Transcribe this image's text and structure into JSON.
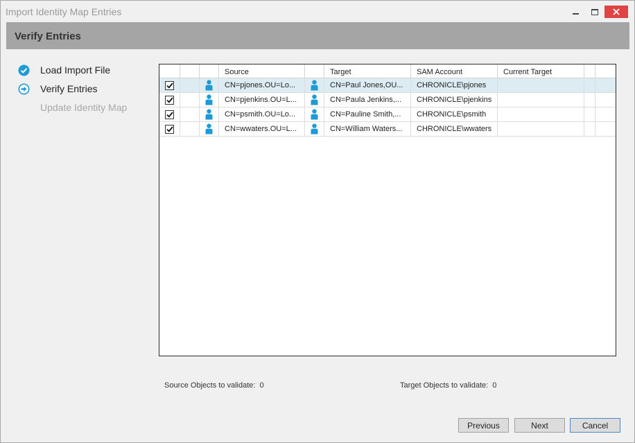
{
  "window": {
    "title": "Import Identity Map Entries"
  },
  "header": {
    "title": "Verify Entries"
  },
  "steps": [
    {
      "label": "Load Import File",
      "state": "completed",
      "icon": "check-circle-icon"
    },
    {
      "label": "Verify Entries",
      "state": "current",
      "icon": "arrow-circle-icon"
    },
    {
      "label": "Update Identity Map",
      "state": "pending",
      "icon": ""
    }
  ],
  "grid": {
    "columns": [
      "",
      "",
      "",
      "Source",
      "",
      "Target",
      "SAM Account",
      "Current Target",
      ""
    ],
    "rows": [
      {
        "checked": true,
        "source": "CN=pjones.OU=Lo...",
        "target": "CN=Paul Jones,OU...",
        "sam": "CHRONICLE\\pjones",
        "current": "",
        "selected": true
      },
      {
        "checked": true,
        "source": "CN=pjenkins.OU=L...",
        "target": "CN=Paula Jenkins,...",
        "sam": "CHRONICLE\\pjenkins",
        "current": "",
        "selected": false
      },
      {
        "checked": true,
        "source": "CN=psmith.OU=Lo...",
        "target": "CN=Pauline Smith,...",
        "sam": "CHRONICLE\\psmith",
        "current": "",
        "selected": false
      },
      {
        "checked": true,
        "source": "CN=wwaters.OU=L...",
        "target": "CN=William Waters...",
        "sam": "CHRONICLE\\wwaters",
        "current": "",
        "selected": false
      }
    ],
    "user_icon": "user-icon"
  },
  "footer": {
    "source_label": "Source Objects to validate:",
    "source_value": "0",
    "target_label": "Target Objects to validate:",
    "target_value": "0"
  },
  "buttons": {
    "previous": "Previous",
    "next": "Next",
    "cancel": "Cancel"
  },
  "colors": {
    "accent": "#1e9ad6",
    "header_bg": "#a5a5a5",
    "selected_row": "#dcecf2",
    "close_button": "#e04343"
  }
}
